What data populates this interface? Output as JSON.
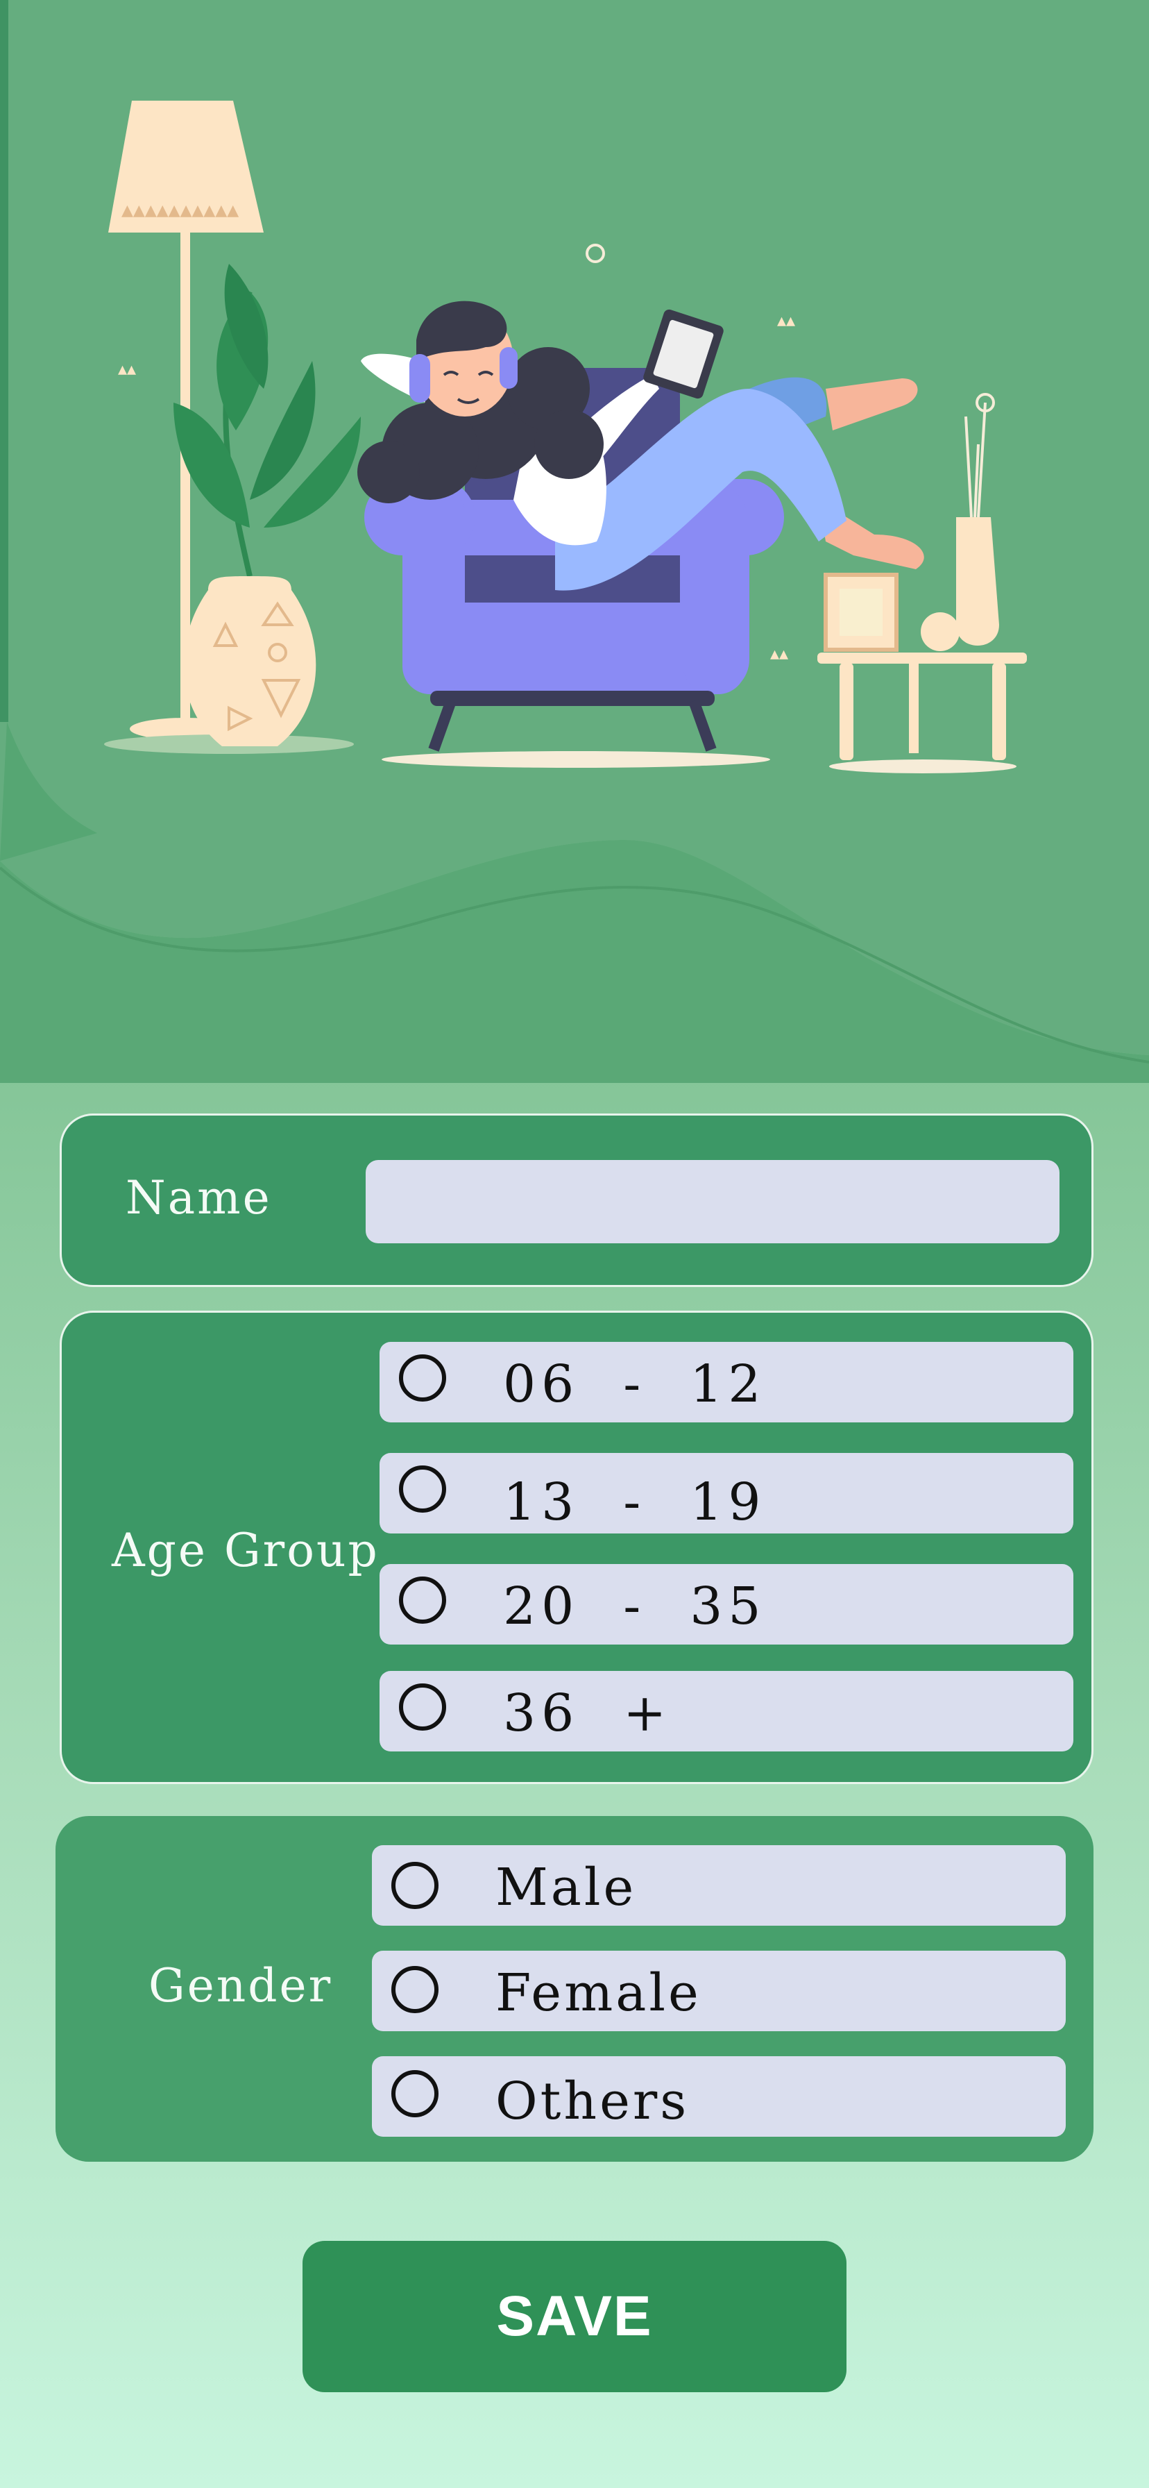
{
  "form": {
    "name_label": "Name",
    "name_value": "",
    "age_label": "Age  Group",
    "age_options": [
      "06  -  12",
      "13  -  19",
      "20  -  35",
      "36  +"
    ],
    "gender_label": "Gender",
    "gender_options": [
      "Male",
      "Female",
      "Others"
    ],
    "save_label": "SAVE"
  },
  "colors": {
    "card": "#3c9866",
    "option_bg": "#dadeee",
    "save_button": "#2f9157"
  }
}
